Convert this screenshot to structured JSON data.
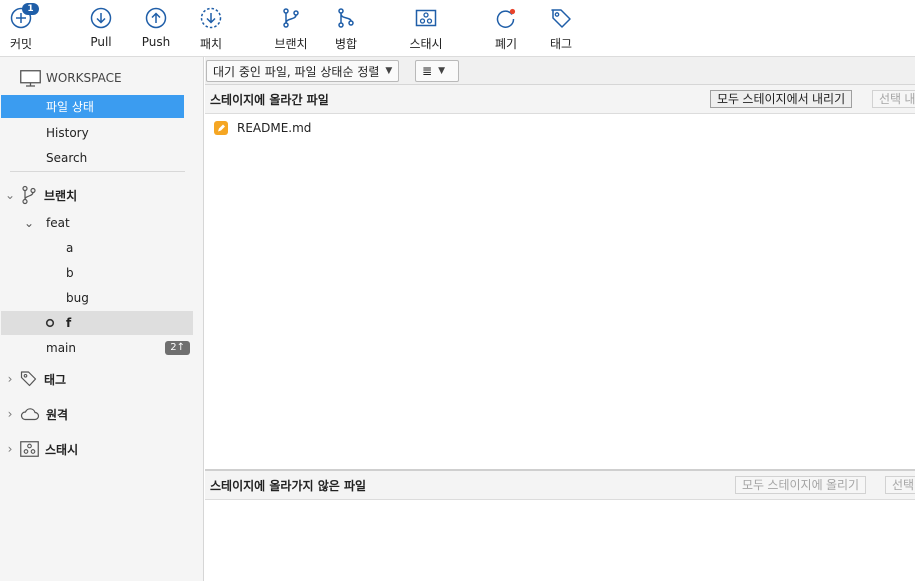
{
  "toolbar": {
    "commit": {
      "label": "커밋",
      "badge": "1",
      "icon": "plus-circle-icon"
    },
    "pull": {
      "label": "Pull",
      "icon": "arrow-down-circle-icon"
    },
    "push": {
      "label": "Push",
      "icon": "arrow-up-circle-icon"
    },
    "patch": {
      "label": "패치",
      "icon": "patch-icon"
    },
    "branch": {
      "label": "브랜치",
      "icon": "branch-icon"
    },
    "merge": {
      "label": "병합",
      "icon": "merge-icon"
    },
    "stash": {
      "label": "스태시",
      "icon": "stash-icon"
    },
    "discard": {
      "label": "폐기",
      "icon": "discard-icon"
    },
    "tag": {
      "label": "태그",
      "icon": "tag-icon"
    }
  },
  "sidebar": {
    "workspace": {
      "label": "WORKSPACE"
    },
    "workspace_items": [
      {
        "label": "파일 상태",
        "selected": true
      },
      {
        "label": "History",
        "selected": false
      },
      {
        "label": "Search",
        "selected": false
      }
    ],
    "branches": {
      "label": "브랜치",
      "folder": "feat",
      "feat_children": [
        "a",
        "b",
        "bug",
        "f"
      ],
      "current": "f",
      "main": {
        "label": "main",
        "ahead": "2↑"
      }
    },
    "tags": {
      "label": "태그"
    },
    "remotes": {
      "label": "원격"
    },
    "stashes": {
      "label": "스태시"
    }
  },
  "main": {
    "filter": {
      "sort_label": "대기 중인 파일, 파일 상태순 정렬",
      "view_label": "≣"
    },
    "staged": {
      "title": "스테이지에 올라간 파일",
      "unstage_all_label": "모두 스테이지에서 내리기",
      "unstage_selected_label": "선택 내",
      "files": [
        {
          "name": "README.md",
          "status": "modified"
        }
      ]
    },
    "unstaged": {
      "title": "스테이지에 올라가지 않은 파일",
      "stage_all_label": "모두 스테이지에 올리기",
      "stage_selected_label": "선택"
    }
  },
  "colors": {
    "accent": "#3b9cf0",
    "icon_blue": "#1f5ea8",
    "modified": "#f5a623",
    "badge": "#6f6f6f"
  }
}
